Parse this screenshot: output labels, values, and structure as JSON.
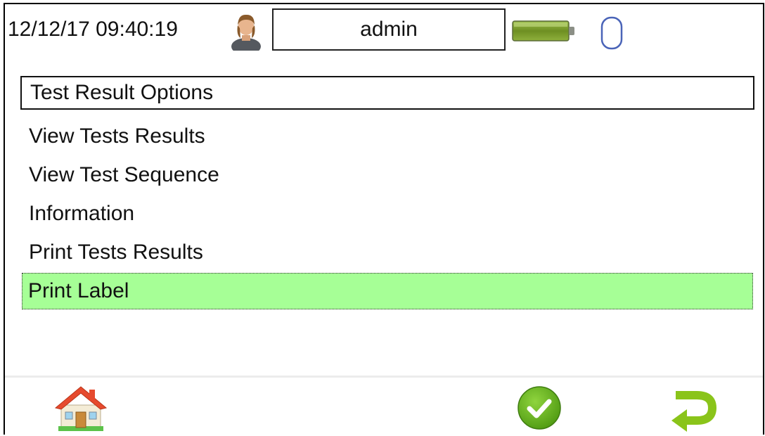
{
  "status_bar": {
    "datetime": "12/12/17 09:40:19",
    "user_icon": "user-icon",
    "username": "admin",
    "battery_icon": "battery-icon",
    "mouse_icon": "mouse-icon"
  },
  "menu": {
    "title": "Test Result Options",
    "items": [
      {
        "label": "View Tests Results"
      },
      {
        "label": "View Test Sequence"
      },
      {
        "label": "Information"
      },
      {
        "label": "Print Tests Results"
      },
      {
        "label": "Print Label"
      }
    ],
    "selected_label": "Print Label"
  },
  "bottom_bar": {
    "home_icon": "home-icon",
    "ok_icon": "check-icon",
    "back_icon": "return-arrow-icon"
  },
  "colors": {
    "selected_background": "#a6ff96",
    "ok_green": "#6cb520",
    "back_green": "#8ac41a",
    "battery_green": "#7a9a2a",
    "home_roof": "#e64a2e"
  }
}
